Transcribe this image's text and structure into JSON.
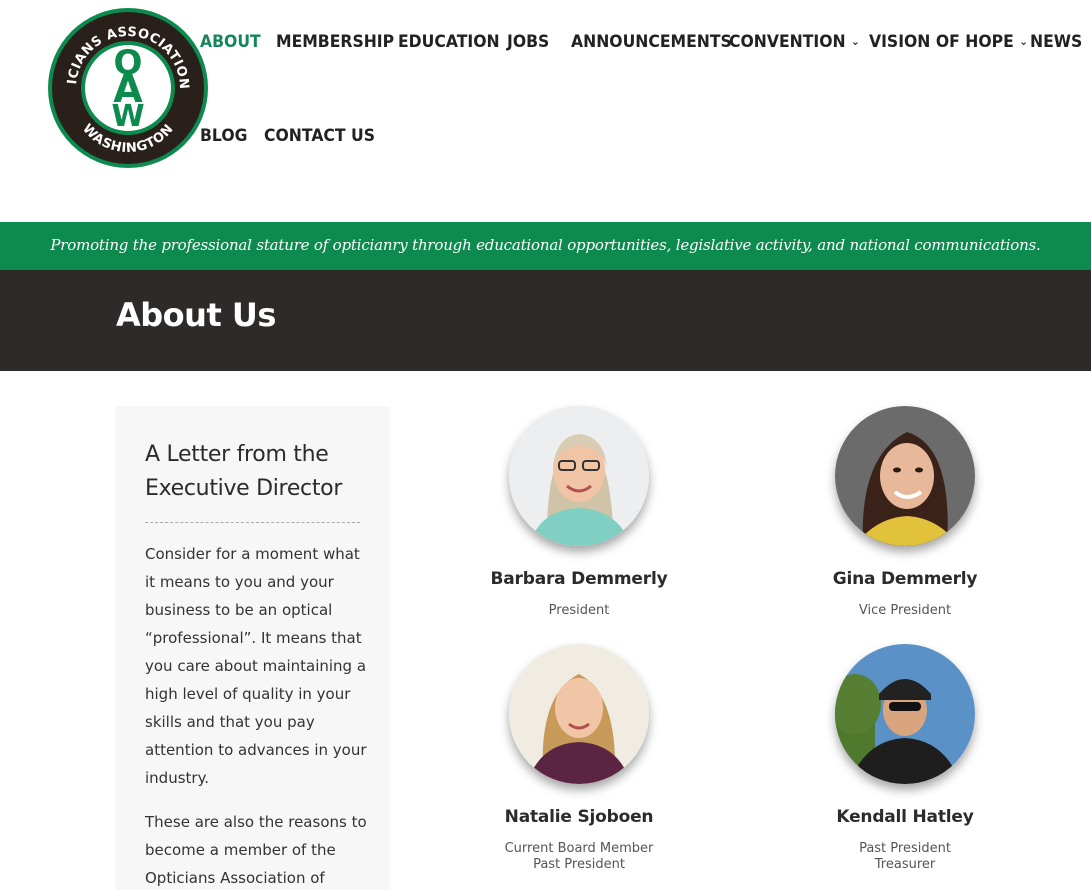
{
  "logo": {
    "text_top": "OPTICIANS ASSOCIATION OF",
    "text_bottom": "WASHINGTON",
    "monogram": "OAW"
  },
  "nav": {
    "items": [
      {
        "label": "ABOUT",
        "active": true
      },
      {
        "label": "MEMBERSHIP"
      },
      {
        "label": "EDUCATION"
      },
      {
        "label": "JOBS"
      },
      {
        "label": "ANNOUNCEMENTS"
      },
      {
        "label": "CONVENTION",
        "dropdown": true
      },
      {
        "label": "VISION OF HOPE",
        "dropdown": true
      },
      {
        "label": "NEWS"
      },
      {
        "label": "BLOG"
      },
      {
        "label": "CONTACT US"
      }
    ]
  },
  "tagline": "Promoting the professional stature of opticianry through educational opportunities, legislative activity, and national communications.",
  "page_title": "About Us",
  "letter": {
    "heading": "A Letter from the Executive Director",
    "paragraphs": [
      "Consider for a moment what it means to you and your business to be an optical “professional”. It means that you care about maintaining a high level of quality in your skills and that you pay attention to advances in your industry.",
      "These are also the reasons to become a member of the Opticians Association of"
    ]
  },
  "board": [
    {
      "name": "Barbara Demmerly",
      "role_line1": "President",
      "role_line2": ""
    },
    {
      "name": "Gina Demmerly",
      "role_line1": "Vice President",
      "role_line2": ""
    },
    {
      "name": "Natalie Sjoboen",
      "role_line1": "Current Board Member",
      "role_line2": "Past President"
    },
    {
      "name": "Kendall Hatley",
      "role_line1": "Past President",
      "role_line2": "Treasurer"
    }
  ],
  "colors": {
    "brand_green": "#0d8a4e",
    "active_nav": "#13875a",
    "title_bar": "#2d2a29"
  }
}
